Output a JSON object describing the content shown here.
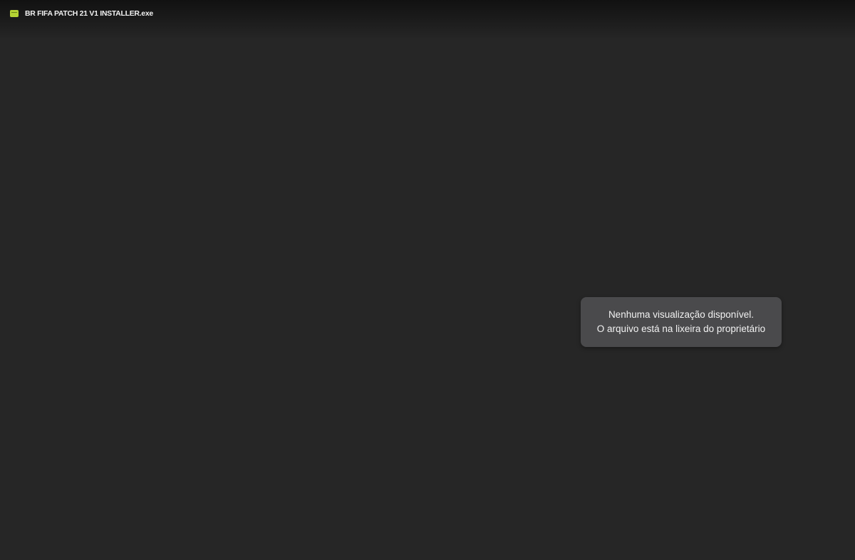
{
  "header": {
    "file_icon": "executable-file-icon",
    "file_icon_color": "#b5d334",
    "file_name": "BR FIFA PATCH 21 V1 INSTALLER.exe"
  },
  "preview": {
    "notice_line_1": "Nenhuma visualização disponível.",
    "notice_line_2": "O arquivo está na lixeira do proprietário"
  },
  "colors": {
    "background": "#262626",
    "notice_background": "#4a4a4c",
    "text": "#f1f1f1"
  }
}
